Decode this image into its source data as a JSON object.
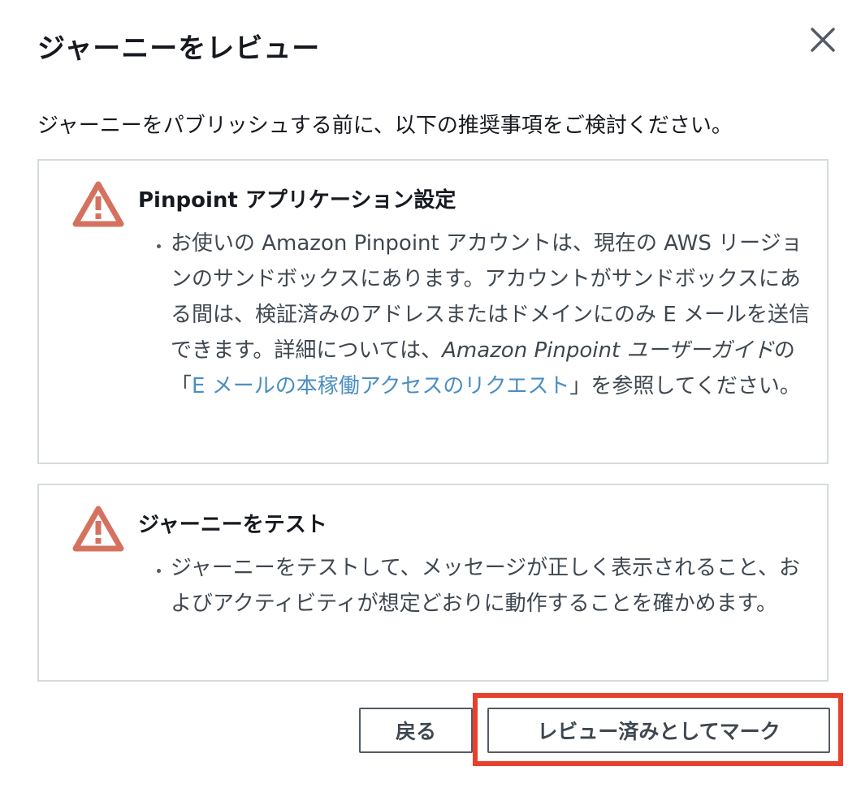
{
  "modal": {
    "title": "ジャーニーをレビュー",
    "close_icon": "close-icon",
    "intro": "ジャーニーをパブリッシュする前に、以下の推奨事項をご検討ください。"
  },
  "cards": [
    {
      "icon": "warning-icon",
      "title": "Pinpoint アプリケーション設定",
      "bullet": {
        "text_before": "お使いの Amazon Pinpoint アカウントは、現在の AWS リージョンのサンドボックスにあります。アカウントがサンドボックスにある間は、検証済みのアドレスまたはドメインにのみ E メールを送信できます。詳細については、",
        "guide_name": "Amazon Pinpoint ユーザーガイド",
        "text_mid": "の「",
        "link_text": "E メールの本稼働アクセスのリクエスト",
        "text_after": "」を参照してください。"
      }
    },
    {
      "icon": "warning-icon",
      "title": "ジャーニーをテスト",
      "bullet": {
        "text": "ジャーニーをテストして、メッセージが正しく表示されること、およびアクティビティが想定どおりに動作することを確かめます。"
      }
    }
  ],
  "footer": {
    "back_label": "戻る",
    "mark_label": "レビュー済みとしてマーク"
  },
  "colors": {
    "warning": "#d5725f",
    "link": "#4a8ec2",
    "highlight": "#e8402c",
    "border": "#d5dbdb"
  }
}
